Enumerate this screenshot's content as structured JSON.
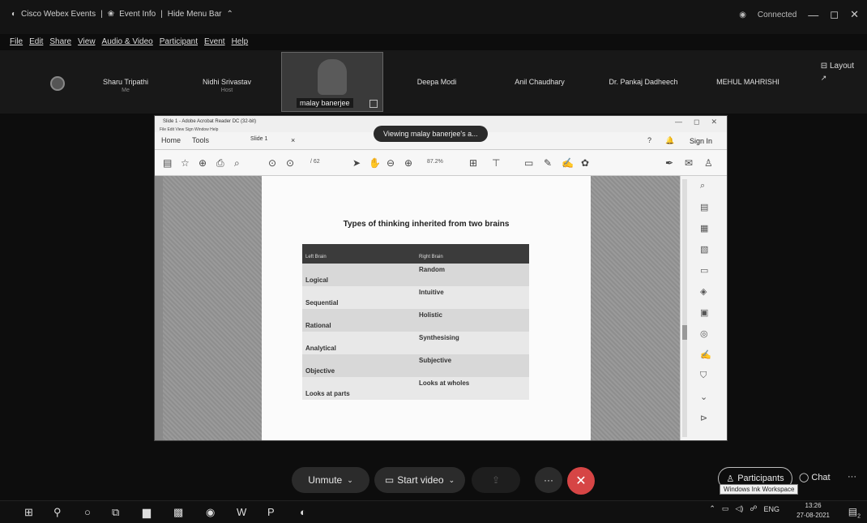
{
  "titlebar": {
    "app": "Cisco Webex Events",
    "event_info": "Event Info",
    "hide_menu": "Hide Menu Bar",
    "status": "Connected"
  },
  "menu": [
    "File",
    "Edit",
    "Share",
    "View",
    "Audio & Video",
    "Participant",
    "Event",
    "Help"
  ],
  "participants": [
    {
      "name": "Sharu Tripathi",
      "role": "Me"
    },
    {
      "name": "Nidhi Srivastav",
      "role": "Host"
    },
    {
      "name": "Deepa Modi",
      "role": ""
    },
    {
      "name": "Anil Chaudhary",
      "role": ""
    },
    {
      "name": "Dr. Pankaj Dadheech",
      "role": ""
    },
    {
      "name": "MEHUL MAHRISHI",
      "role": ""
    }
  ],
  "active_speaker": "malay banerjee",
  "layout_label": "Layout",
  "share": {
    "window_title": "Slide 1 - Adobe Acrobat Reader DC (32-bit)",
    "acro_menu": "File  Edit  View  Sign  Window  Help",
    "tabs": [
      "Home",
      "Tools",
      "Slide 1"
    ],
    "sign_in": "Sign In",
    "viewing_banner": "Viewing malay banerjee's a...",
    "page_indicator": "/ 62",
    "zoom": "87.2%",
    "doc_title": "Types of thinking inherited from two brains",
    "table": {
      "headers": [
        "Left Brain",
        "Right Brain"
      ],
      "rows": [
        [
          "Logical",
          "Random"
        ],
        [
          "Sequential",
          "Intuitive"
        ],
        [
          "Rational",
          "Holistic"
        ],
        [
          "Analytical",
          "Synthesising"
        ],
        [
          "Objective",
          "Subjective"
        ],
        [
          "Looks at parts",
          "Looks at wholes"
        ]
      ]
    }
  },
  "controls": {
    "unmute": "Unmute",
    "start_video": "Start video",
    "participants": "Participants",
    "chat": "Chat",
    "tooltip": "Windows Ink Workspace"
  },
  "taskbar": {
    "lang": "ENG",
    "time": "13:26",
    "date": "27-08-2021",
    "notif_count": "2"
  }
}
